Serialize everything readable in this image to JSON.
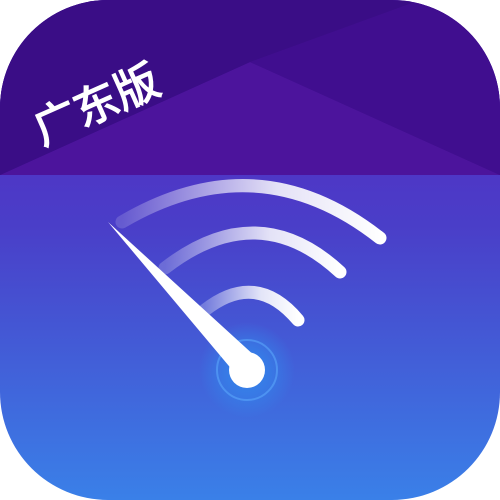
{
  "app_icon": {
    "badge_label": "广东版",
    "icon_name": "wifi-speedometer-icon",
    "colors": {
      "banner_dark": "#3a0d86",
      "banner_light": "#4c149c",
      "gradient_top": "#5a1fc0",
      "gradient_mid": "#4a4bd0",
      "gradient_bottom": "#3a7fe6",
      "arc_white": "#ffffff",
      "needle_white": "#ffffff",
      "pivot_glow": "#2f8ff0"
    }
  }
}
